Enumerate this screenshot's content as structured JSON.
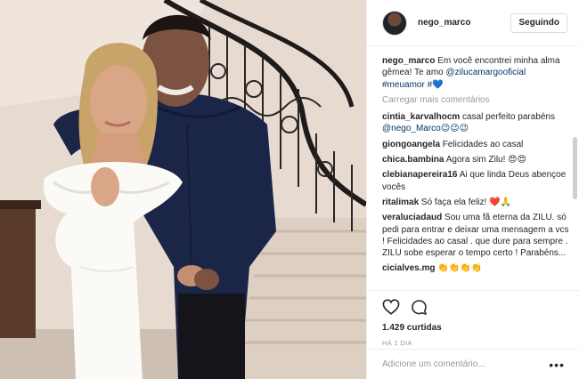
{
  "post": {
    "username": "nego_marco",
    "follow_label": "Seguindo",
    "caption": {
      "username": "nego_marco",
      "text": " Em você encontrei minha alma gêmea! Te amo ",
      "mention": "@zilucamargooficial",
      "hashtags": "#meuamor #💙"
    },
    "load_more": "Carregar mais comentários",
    "comments": [
      {
        "user": "cintia_karvalhocm",
        "text": " casal perfeito parabéns ",
        "mention": "@nego_Marco😉😉😉"
      },
      {
        "user": "giongoangela",
        "text": " Felicidades ao casal",
        "mention": ""
      },
      {
        "user": "chica.bambina",
        "text": " Agora sim Zilu! 😍😍",
        "mention": ""
      },
      {
        "user": "clebianapereira16",
        "text": " Ai que linda Deus abençoe vocês",
        "mention": ""
      },
      {
        "user": "ritalimak",
        "text": " Só faça ela feliz! ❤️🙏",
        "mention": ""
      },
      {
        "user": "veraluciadaud",
        "text": " Sou uma fã eterna da ZILU. só pedi para entrar e deixar uma mensagem a vcs ! Felicidades ao casal . que dure para sempre . ZILU sobe esperar o tempo certo ! Parabéns...",
        "mention": ""
      },
      {
        "user": "cicialves.mg",
        "text": " 👏👏👏👏",
        "mention": ""
      }
    ],
    "likes": "1.429 curtidas",
    "time": "HÁ 1 DIA",
    "comment_placeholder": "Adicione um comentário...",
    "more_options": "•••",
    "icons": {
      "like": "heart-icon",
      "comment": "speech-bubble-icon"
    }
  }
}
